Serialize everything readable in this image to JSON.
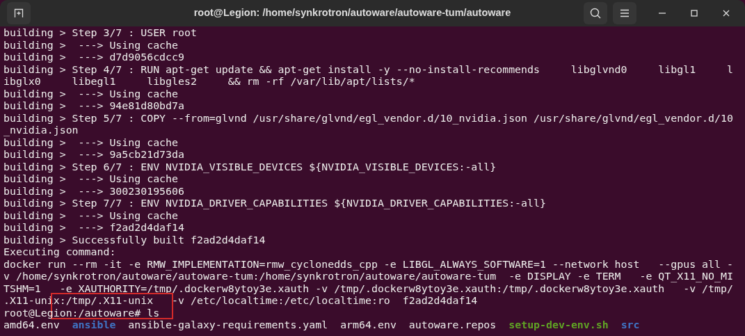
{
  "window": {
    "title": "root@Legion: /home/synkrotron/autoware/autoware-tum/autoware"
  },
  "terminal": {
    "lines": [
      "building > Step 3/7 : USER root",
      "building >  ---> Using cache",
      "building >  ---> d7d9056cdcc9",
      "building > Step 4/7 : RUN apt-get update && apt-get install -y --no-install-recommends     libglvnd0     libgl1     l",
      "ibglx0     libegl1     libgles2     && rm -rf /var/lib/apt/lists/*",
      "building >  ---> Using cache",
      "building >  ---> 94e81d80bd7a",
      "building > Step 5/7 : COPY --from=glvnd /usr/share/glvnd/egl_vendor.d/10_nvidia.json /usr/share/glvnd/egl_vendor.d/10",
      "_nvidia.json",
      "building >  ---> Using cache",
      "building >  ---> 9a5cb21d73da",
      "building > Step 6/7 : ENV NVIDIA_VISIBLE_DEVICES ${NVIDIA_VISIBLE_DEVICES:-all}",
      "building >  ---> Using cache",
      "building >  ---> 300230195606",
      "building > Step 7/7 : ENV NVIDIA_DRIVER_CAPABILITIES ${NVIDIA_DRIVER_CAPABILITIES:-all}",
      "building >  ---> Using cache",
      "building >  ---> f2ad2d4daf14",
      "building > Successfully built f2ad2d4daf14",
      "Executing command:",
      "docker run --rm -it -e RMW_IMPLEMENTATION=rmw_cyclonedds_cpp -e LIBGL_ALWAYS_SOFTWARE=1 --network host   --gpus all -",
      "v /home/synkrotron/autoware/autoware-tum:/home/synkrotron/autoware/autoware-tum  -e DISPLAY -e TERM   -e QT_X11_NO_MI",
      "TSHM=1   -e XAUTHORITY=/tmp/.dockerw8ytoy3e.xauth -v /tmp/.dockerw8ytoy3e.xauth:/tmp/.dockerw8ytoy3e.xauth   -v /tmp/",
      ".X11-unix:/tmp/.X11-unix   -v /etc/localtime:/etc/localtime:ro  f2ad2d4daf14",
      "root@Legion:/autoware# ls"
    ],
    "listing": [
      {
        "text": "amd64.env",
        "kind": "file"
      },
      {
        "text": "ansible",
        "kind": "directory"
      },
      {
        "text": "ansible-galaxy-requirements.yaml",
        "kind": "file"
      },
      {
        "text": "arm64.env",
        "kind": "file"
      },
      {
        "text": "autoware.repos",
        "kind": "file"
      },
      {
        "text": "setup-dev-env.sh",
        "kind": "executable"
      },
      {
        "text": "src",
        "kind": "directory"
      }
    ]
  },
  "highlight": {
    "color": "#d42a2a"
  }
}
